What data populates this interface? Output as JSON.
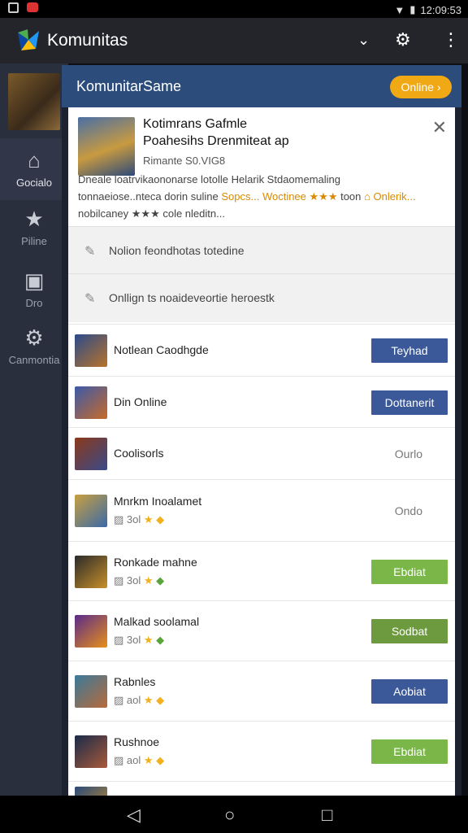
{
  "status_bar": {
    "time": "12:09:53"
  },
  "app_bar": {
    "title": "Komunitas"
  },
  "sidebar": {
    "items": [
      {
        "label": "Gocialo"
      },
      {
        "label": "Piline"
      },
      {
        "label": "Dro"
      },
      {
        "label": "Canmontia"
      }
    ]
  },
  "panel": {
    "title": "KomunitarSame",
    "online_label": "Online ›"
  },
  "hero": {
    "title": "Kotimrans Gafmle",
    "subtitle": "Poahesihs Drenmiteat ap",
    "meta": "Rimante  S0.VIG8",
    "desc_line1": "Dneale loatrvikaononarse lotolle Helarik Stdaomemaling",
    "desc_line2_a": "tonnaeiose..nteca dorin suline ",
    "desc_line2_hl": "Sopcs...  Woctinee ★★★ ",
    "desc_line2_b": "toon ",
    "desc_line2_hl2": "⌂ Onlerik...",
    "desc_line3": "nobilcaney ★★★ cole nleditn..."
  },
  "prompts": [
    {
      "text": "Nolion feondhotas totedine"
    },
    {
      "text": "Onllign ts noaideveortie heroestk"
    }
  ],
  "list": [
    {
      "name": "Notlean Caodhgde",
      "meta": "",
      "action": "Teyhad",
      "action_style": "blue",
      "colors": [
        "#2b4a8a",
        "#b8742a"
      ]
    },
    {
      "name": "Din Online",
      "meta": "",
      "action": "Dottanerit",
      "action_style": "blue",
      "colors": [
        "#3a5aa8",
        "#c86a2a"
      ]
    },
    {
      "name": "Coolisorls",
      "meta": "",
      "action": "Ourlo",
      "action_style": "text",
      "colors": [
        "#8a3a1a",
        "#3a4a8a"
      ]
    },
    {
      "name": "Mnrkm Inoalamet",
      "meta": "3ol",
      "action": "Ondo",
      "action_style": "text",
      "colors": [
        "#c8a040",
        "#3a6aa8"
      ]
    },
    {
      "name": "Ronkade mahne",
      "meta": "3ol",
      "action": "Ebdiat",
      "action_style": "green",
      "colors": [
        "#2a2a2a",
        "#c8902a"
      ]
    },
    {
      "name": "Malkad soolamal",
      "meta": "3ol",
      "action": "Sodbat",
      "action_style": "olive",
      "colors": [
        "#5a2a8a",
        "#e8901a"
      ]
    },
    {
      "name": "Rabnles",
      "meta": "aol",
      "action": "Aobiat",
      "action_style": "blue",
      "colors": [
        "#3a7a9a",
        "#b86a3a"
      ]
    },
    {
      "name": "Rushnoe",
      "meta": "aol",
      "action": "Ebdiat",
      "action_style": "green",
      "colors": [
        "#1a2a4a",
        "#a85a3a"
      ]
    }
  ]
}
